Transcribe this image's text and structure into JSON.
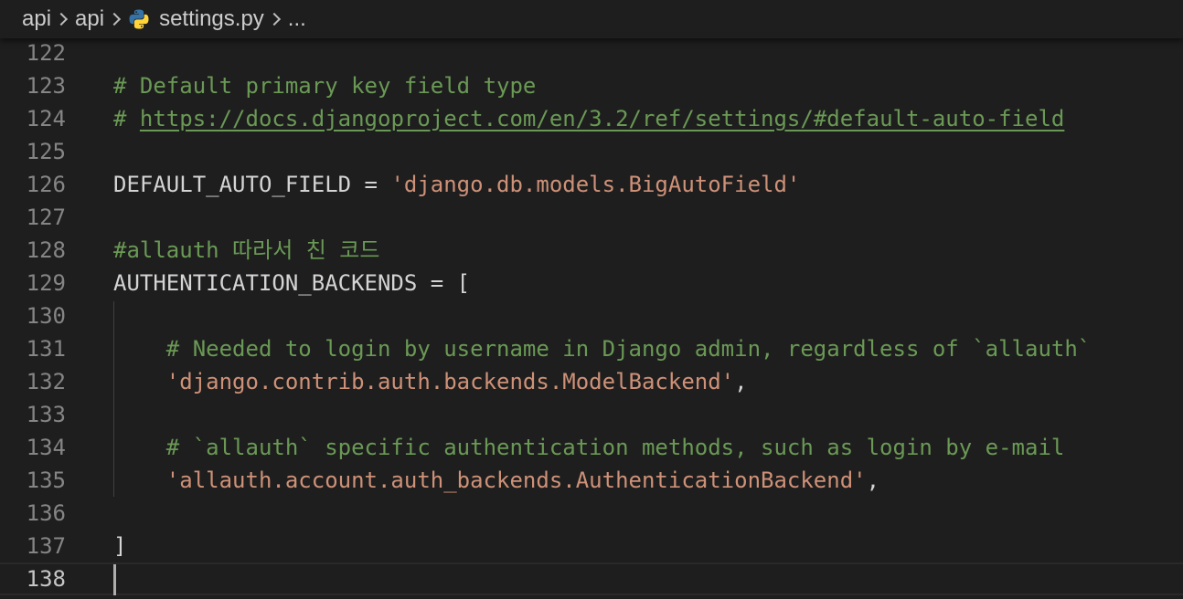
{
  "breadcrumb": {
    "items": [
      "api",
      "api"
    ],
    "file": "settings.py",
    "more": "..."
  },
  "colors": {
    "background": "#1e1e1e",
    "comment": "#6a9955",
    "string": "#ce9178",
    "text": "#d4d4d4",
    "line_number": "#858585",
    "python_icon_blue": "#3572a5",
    "python_icon_yellow": "#ffd43b"
  },
  "icons": {
    "file_type": "python-icon",
    "separator": "chevron-right-icon"
  },
  "editor": {
    "lines": [
      {
        "num": "122",
        "parts": []
      },
      {
        "num": "123",
        "parts": [
          {
            "cls": "comment",
            "text": "# Default primary key field type"
          }
        ]
      },
      {
        "num": "124",
        "parts": [
          {
            "cls": "comment",
            "text": "# "
          },
          {
            "cls": "link",
            "text": "https://docs.djangoproject.com/en/3.2/ref/settings/#default-auto-field"
          }
        ]
      },
      {
        "num": "125",
        "parts": []
      },
      {
        "num": "126",
        "parts": [
          {
            "cls": "plain",
            "text": "DEFAULT_AUTO_FIELD = "
          },
          {
            "cls": "string",
            "text": "'django.db.models.BigAutoField'"
          }
        ]
      },
      {
        "num": "127",
        "parts": []
      },
      {
        "num": "128",
        "parts": [
          {
            "cls": "comment",
            "text": "#allauth 따라서 친 코드"
          }
        ]
      },
      {
        "num": "129",
        "parts": [
          {
            "cls": "plain",
            "text": "AUTHENTICATION_BACKENDS = ["
          }
        ]
      },
      {
        "num": "130",
        "parts": []
      },
      {
        "num": "131",
        "parts": [
          {
            "cls": "plain",
            "text": "    "
          },
          {
            "cls": "comment",
            "text": "# Needed to login by username in Django admin, regardless of `allauth`"
          }
        ]
      },
      {
        "num": "132",
        "parts": [
          {
            "cls": "plain",
            "text": "    "
          },
          {
            "cls": "string",
            "text": "'django.contrib.auth.backends.ModelBackend'"
          },
          {
            "cls": "plain",
            "text": ","
          }
        ]
      },
      {
        "num": "133",
        "parts": []
      },
      {
        "num": "134",
        "parts": [
          {
            "cls": "plain",
            "text": "    "
          },
          {
            "cls": "comment",
            "text": "# `allauth` specific authentication methods, such as login by e-mail"
          }
        ]
      },
      {
        "num": "135",
        "parts": [
          {
            "cls": "plain",
            "text": "    "
          },
          {
            "cls": "string",
            "text": "'allauth.account.auth_backends.AuthenticationBackend'"
          },
          {
            "cls": "plain",
            "text": ","
          }
        ]
      },
      {
        "num": "136",
        "parts": []
      },
      {
        "num": "137",
        "parts": [
          {
            "cls": "plain",
            "text": "]"
          }
        ]
      },
      {
        "num": "138",
        "parts": []
      }
    ],
    "current_line": "138"
  }
}
